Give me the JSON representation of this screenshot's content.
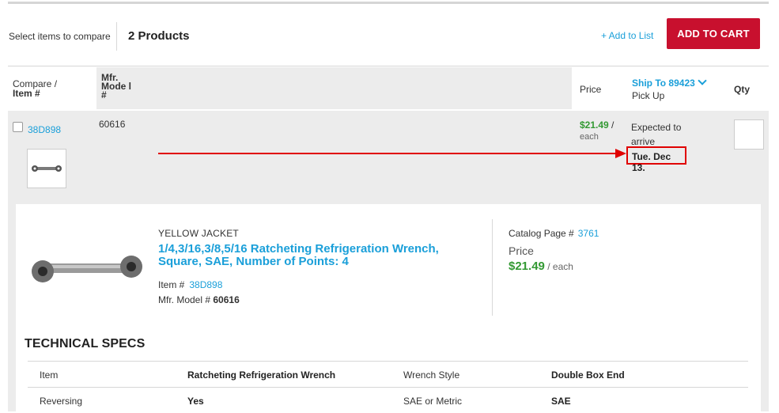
{
  "compare_bar": {
    "select_label": "Select items to compare",
    "products_count": "2 Products",
    "add_to_list": "+ Add to List",
    "add_to_cart": "ADD TO CART"
  },
  "table_headers": {
    "compare": "Compare /",
    "item_num": "Item #",
    "mfr_model": "Mfr. Mode l #",
    "price": "Price",
    "ship_to": "Ship To 89423",
    "pick_up": "Pick Up",
    "qty": "Qty"
  },
  "row": {
    "item_number": "38D898",
    "model_number": "60616",
    "price": "$21.49",
    "price_sep": " /",
    "price_unit": "each",
    "expected": "Expected to arrive",
    "arrival_date": "Tue. Dec 13."
  },
  "detail": {
    "brand": "YELLOW JACKET",
    "title": "1/4,3/16,3/8,5/16 Ratcheting Refrigeration Wrench, Square, SAE, Number of Points: 4",
    "item_label": "Item #",
    "item_number": "38D898",
    "mfr_label": "Mfr. Model #",
    "mfr_number": "60616",
    "catalog_label": "Catalog Page #",
    "catalog_page": "3761",
    "price_label": "Price",
    "price": "$21.49",
    "price_unit": " / each"
  },
  "specs": {
    "heading": "TECHNICAL SPECS",
    "rows": [
      {
        "k1": "Item",
        "v1": "Ratcheting Refrigeration Wrench",
        "k2": "Wrench Style",
        "v2": "Double Box End"
      },
      {
        "k1": "Reversing",
        "v1": "Yes",
        "k2": "SAE or Metric",
        "v2": "SAE"
      }
    ]
  },
  "colors": {
    "accent_blue": "#1a9fd9",
    "cart_red": "#c8102e",
    "price_green": "#339933",
    "annotation_red": "#e00000"
  }
}
